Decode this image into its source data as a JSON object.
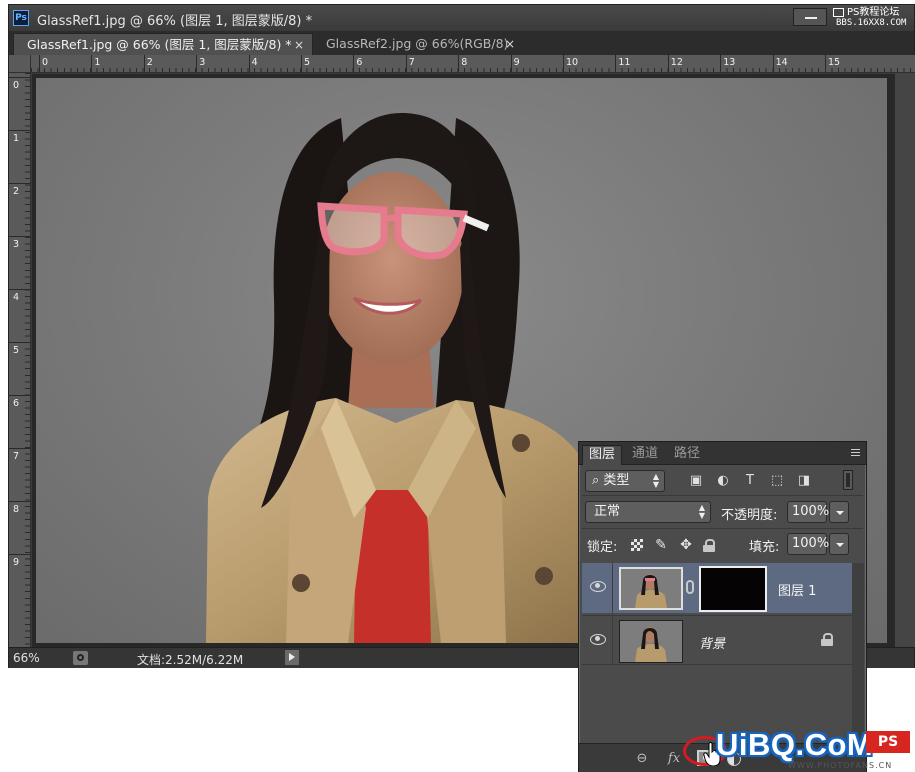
{
  "window": {
    "app_icon": "Ps",
    "title": "GlassRef1.jpg @ 66% (图层 1, 图层蒙版/8) *",
    "forum_watermark": {
      "line1": "PS教程论坛",
      "line2": "BBS.16XX8.COM"
    }
  },
  "tabs": [
    {
      "label": "GlassRef1.jpg @ 66% (图层 1, 图层蒙版/8) *",
      "close": "×",
      "active": true
    },
    {
      "label": "GlassRef2.jpg @ 66%(RGB/8)",
      "close": "×",
      "active": false
    }
  ],
  "ruler": {
    "horizontal": [
      "0",
      "1",
      "2",
      "3",
      "4",
      "5",
      "6",
      "7",
      "8",
      "9",
      "10",
      "11",
      "12",
      "13",
      "14",
      "15"
    ],
    "vertical": [
      "0",
      "1",
      "2",
      "3",
      "4",
      "5",
      "6",
      "7",
      "8",
      "9"
    ]
  },
  "status_bar": {
    "zoom": "66%",
    "doc_size": "文档:2.52M/6.22M"
  },
  "layers_panel": {
    "tabs": [
      "图层",
      "通道",
      "路径"
    ],
    "filter": {
      "kind_label": "类型",
      "icons": [
        "image-filter-icon",
        "adjustment-filter-icon",
        "type-filter-icon",
        "shape-filter-icon",
        "smart-object-filter-icon"
      ]
    },
    "blend_mode": "正常",
    "opacity_label": "不透明度:",
    "opacity_value": "100%",
    "lock_label": "锁定:",
    "fill_label": "填充:",
    "fill_value": "100%",
    "layers": [
      {
        "name": "图层 1",
        "selected": true,
        "has_mask": true
      },
      {
        "name": "背景",
        "selected": false,
        "locked": true
      }
    ],
    "footer_icons": [
      "link-layers-icon",
      "fx-icon",
      "add-mask-icon",
      "adjustment-layer-icon"
    ],
    "highlight_color": "#d71a1f",
    "selected_row_color": "#5d6a82"
  },
  "brand_watermark": {
    "text": "UiBQ.CoM",
    "badge": "PS",
    "sub": "WWW.PHOTOFANS.CN",
    "color": "#1565c0"
  }
}
